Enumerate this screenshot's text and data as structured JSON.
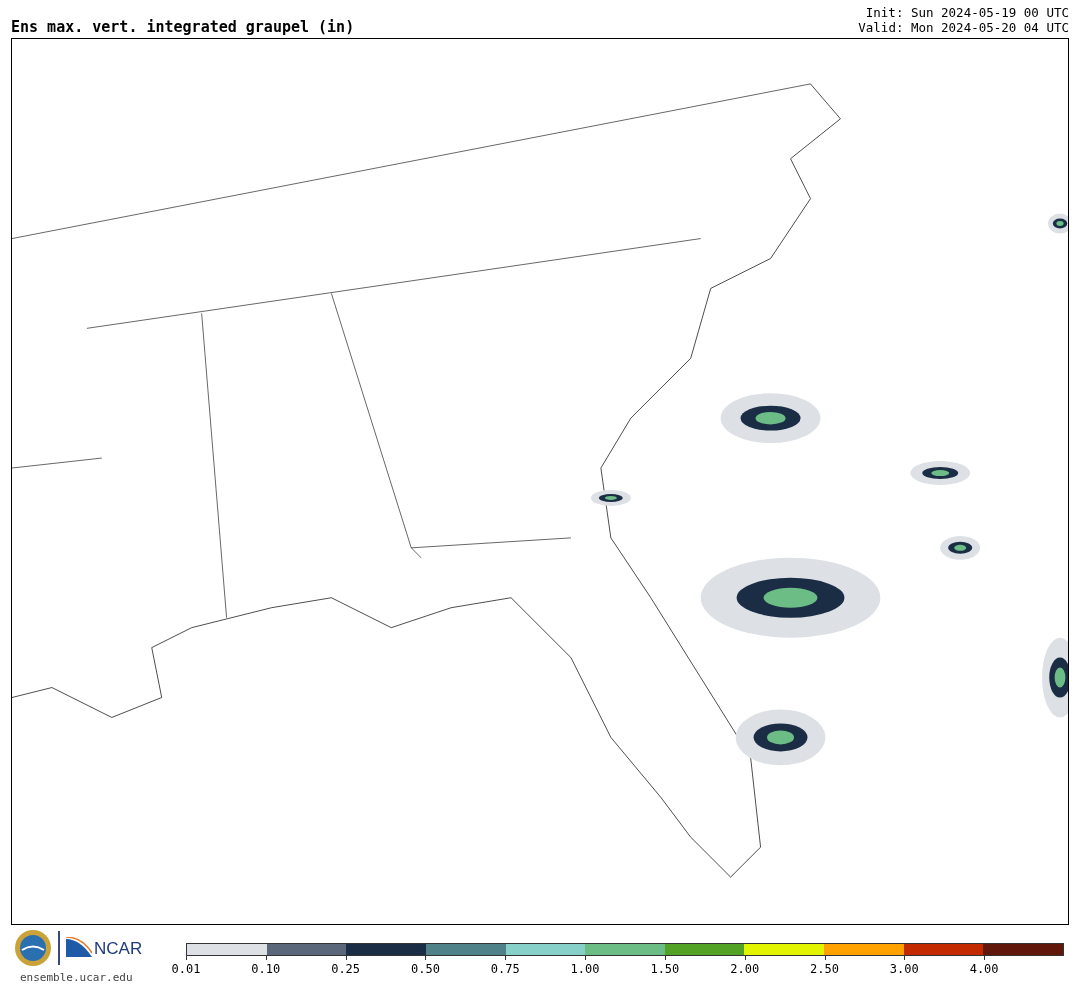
{
  "header": {
    "title": "Ens max. vert. integrated graupel (in)",
    "init": "Init: Sun 2024-05-19 00 UTC",
    "valid": "Valid: Mon 2024-05-20 04 UTC"
  },
  "footer": {
    "ncar_label": "NCAR",
    "website": "ensemble.ucar.edu"
  },
  "colorbar": [
    {
      "label": "0.01",
      "color": "#dde1e5"
    },
    {
      "label": "0.10",
      "color": "#5a6679"
    },
    {
      "label": "0.25",
      "color": "#1b2d45"
    },
    {
      "label": "0.50",
      "color": "#4f8288"
    },
    {
      "label": "0.75",
      "color": "#86d0c9"
    },
    {
      "label": "1.00",
      "color": "#6bbd85"
    },
    {
      "label": "1.50",
      "color": "#52a225"
    },
    {
      "label": "2.00",
      "color": "#e3f400"
    },
    {
      "label": "2.50",
      "color": "#ffa200"
    },
    {
      "label": "3.00",
      "color": "#c42a00"
    },
    {
      "label": "4.00",
      "color": "#611709"
    }
  ]
}
